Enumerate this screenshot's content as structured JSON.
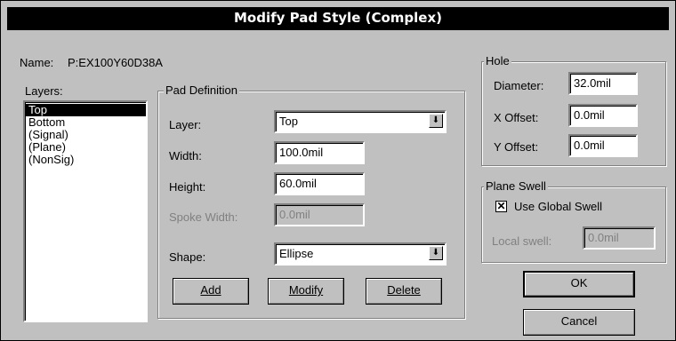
{
  "window": {
    "title": "Modify Pad Style (Complex)"
  },
  "name": {
    "label": "Name:",
    "value": "P:EX100Y60D38A"
  },
  "layers": {
    "label": "Layers:",
    "items": [
      "Top",
      "Bottom",
      "(Signal)",
      "(Plane)",
      "(NonSig)"
    ],
    "selected": "Top"
  },
  "pad_definition": {
    "title": "Pad Definition",
    "layer_label": "Layer:",
    "layer_value": "Top",
    "width_label": "Width:",
    "width_value": "100.0mil",
    "height_label": "Height:",
    "height_value": "60.0mil",
    "spoke_label": "Spoke Width:",
    "spoke_value": "0.0mil",
    "shape_label": "Shape:",
    "shape_value": "Ellipse",
    "add_label": "Add",
    "modify_label": "Modify",
    "delete_label": "Delete"
  },
  "hole": {
    "title": "Hole",
    "diameter_label": "Diameter:",
    "diameter_value": "32.0mil",
    "xoffset_label": "X Offset:",
    "xoffset_value": "0.0mil",
    "yoffset_label": "Y Offset:",
    "yoffset_value": "0.0mil"
  },
  "plane_swell": {
    "title": "Plane Swell",
    "use_global_label": "Use Global Swell",
    "use_global_checked": true,
    "local_label": "Local swell:",
    "local_value": "0.0mil"
  },
  "buttons": {
    "ok": "OK",
    "cancel": "Cancel"
  }
}
